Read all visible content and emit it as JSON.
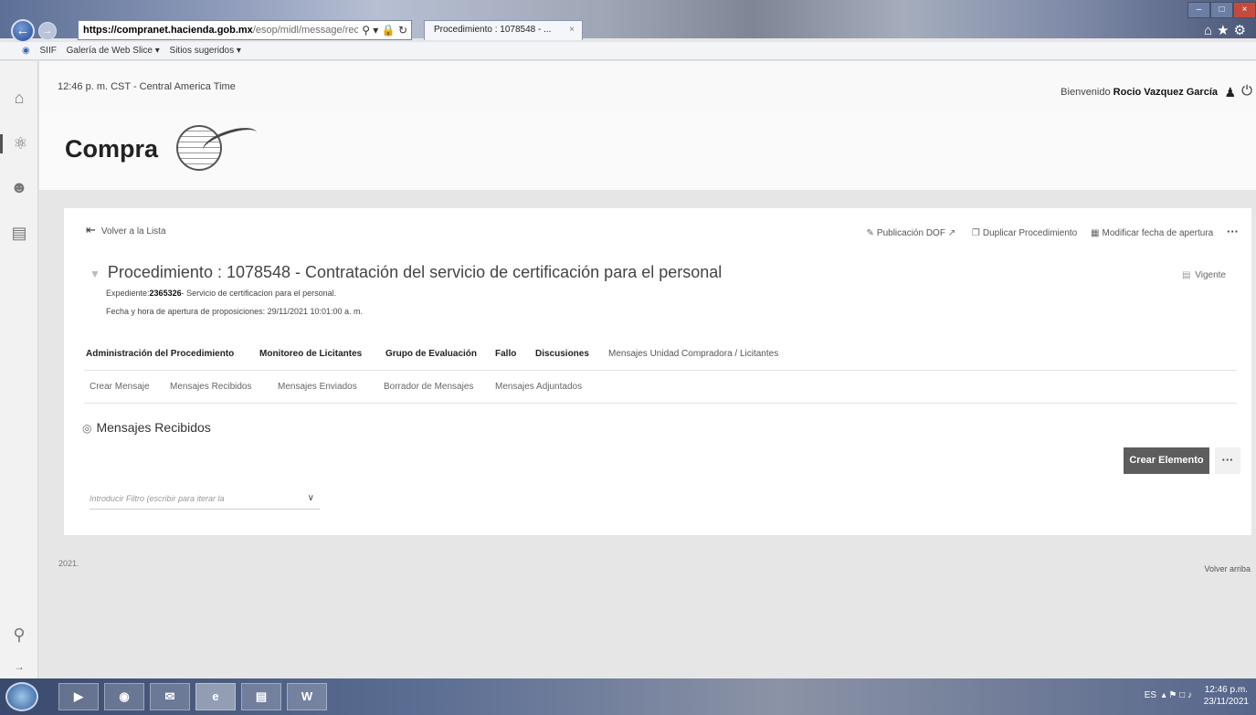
{
  "browser": {
    "url_host": "https://compranet.hacienda.gob.mx",
    "url_path": "/esop/midl/message/receiver",
    "tab_title": "Procedimiento : 1078548 - ...",
    "favorites": [
      "SIIF",
      "Galería de Web Slice ▾",
      "Sitios sugeridos ▾"
    ]
  },
  "header": {
    "clock": "12:46 p. m. CST - Central America Time",
    "welcome_prefix": "Bienvenido",
    "user_name": "Rocio Vazquez García",
    "logo_text": "Compra"
  },
  "toolbar": {
    "back_label": "Volver a la Lista",
    "publicacion": "Publicación DOF",
    "duplicar": "Duplicar Procedimiento",
    "modificar": "Modificar fecha de apertura",
    "more": "···"
  },
  "procedure": {
    "title": "Procedimiento : 1078548 - Contratación del servicio de certificación para el personal",
    "status": "Vigente",
    "expediente_label": "Expediente:",
    "expediente_id": "2365326",
    "expediente_desc": "- Servicio de certificacion para el personal.",
    "fecha": "Fecha y hora de apertura de proposiciones: 29/11/2021 10:01:00 a. m."
  },
  "tabs_main": [
    "Administración del Procedimiento",
    "Monitoreo de Licitantes",
    "Grupo de Evaluación",
    "Fallo",
    "Discusiones",
    "Mensajes Unidad Compradora / Licitantes"
  ],
  "tabs_sub": [
    "Crear Mensaje",
    "Mensajes Recibidos",
    "Mensajes Enviados",
    "Borrador de Mensajes",
    "Mensajes Adjuntados"
  ],
  "section": {
    "title": "Mensajes Recibidos",
    "create_button": "Crear Elemento",
    "filter_placeholder": "Introducir Filtro (escribir para iterar la"
  },
  "footer": {
    "year": "2021.",
    "back_to_top": "Volver arriba"
  },
  "taskbar": {
    "lang": "ES",
    "time": "12:46 p.m.",
    "date": "23/11/2021"
  }
}
